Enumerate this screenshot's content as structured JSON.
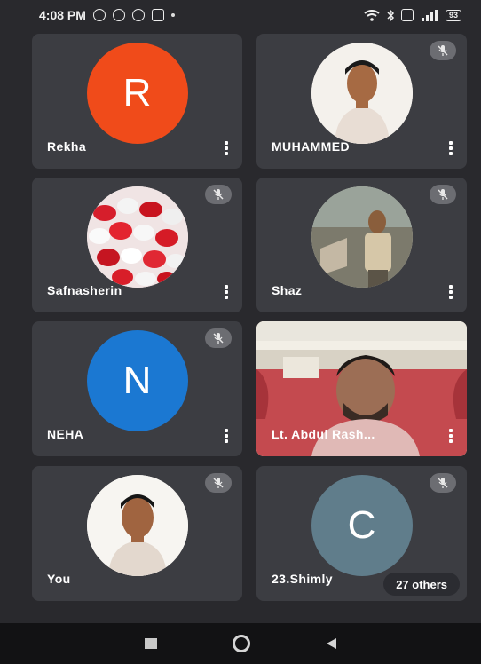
{
  "status_bar": {
    "time": "4:08 PM",
    "battery": "93"
  },
  "tiles": [
    {
      "name": "Rekha",
      "avatar_letter": "R",
      "avatar_color": "#f04b1a",
      "muted": false
    },
    {
      "name": "MUHAMMED",
      "avatar": "photo-man-portrait",
      "muted": true
    },
    {
      "name": "Safnasherin",
      "avatar": "photo-candy-hearts",
      "muted": true
    },
    {
      "name": "Shaz",
      "avatar": "photo-man-outdoor",
      "muted": true
    },
    {
      "name": "NEHA",
      "avatar_letter": "N",
      "avatar_color": "#1b78d2",
      "muted": true
    },
    {
      "name": "Lt. Abdul Rash...",
      "video": "live-camera-feed",
      "muted": false
    },
    {
      "name": "You",
      "avatar": "photo-man-portrait",
      "muted": true
    },
    {
      "name": "23.Shimly",
      "avatar_letter": "C",
      "avatar_color": "#607d8b",
      "muted": true,
      "overflow_label": "27 others"
    }
  ],
  "colors": {
    "background": "#29292d",
    "tile": "#3c3d42",
    "mute_badge": "#6c6d72"
  }
}
